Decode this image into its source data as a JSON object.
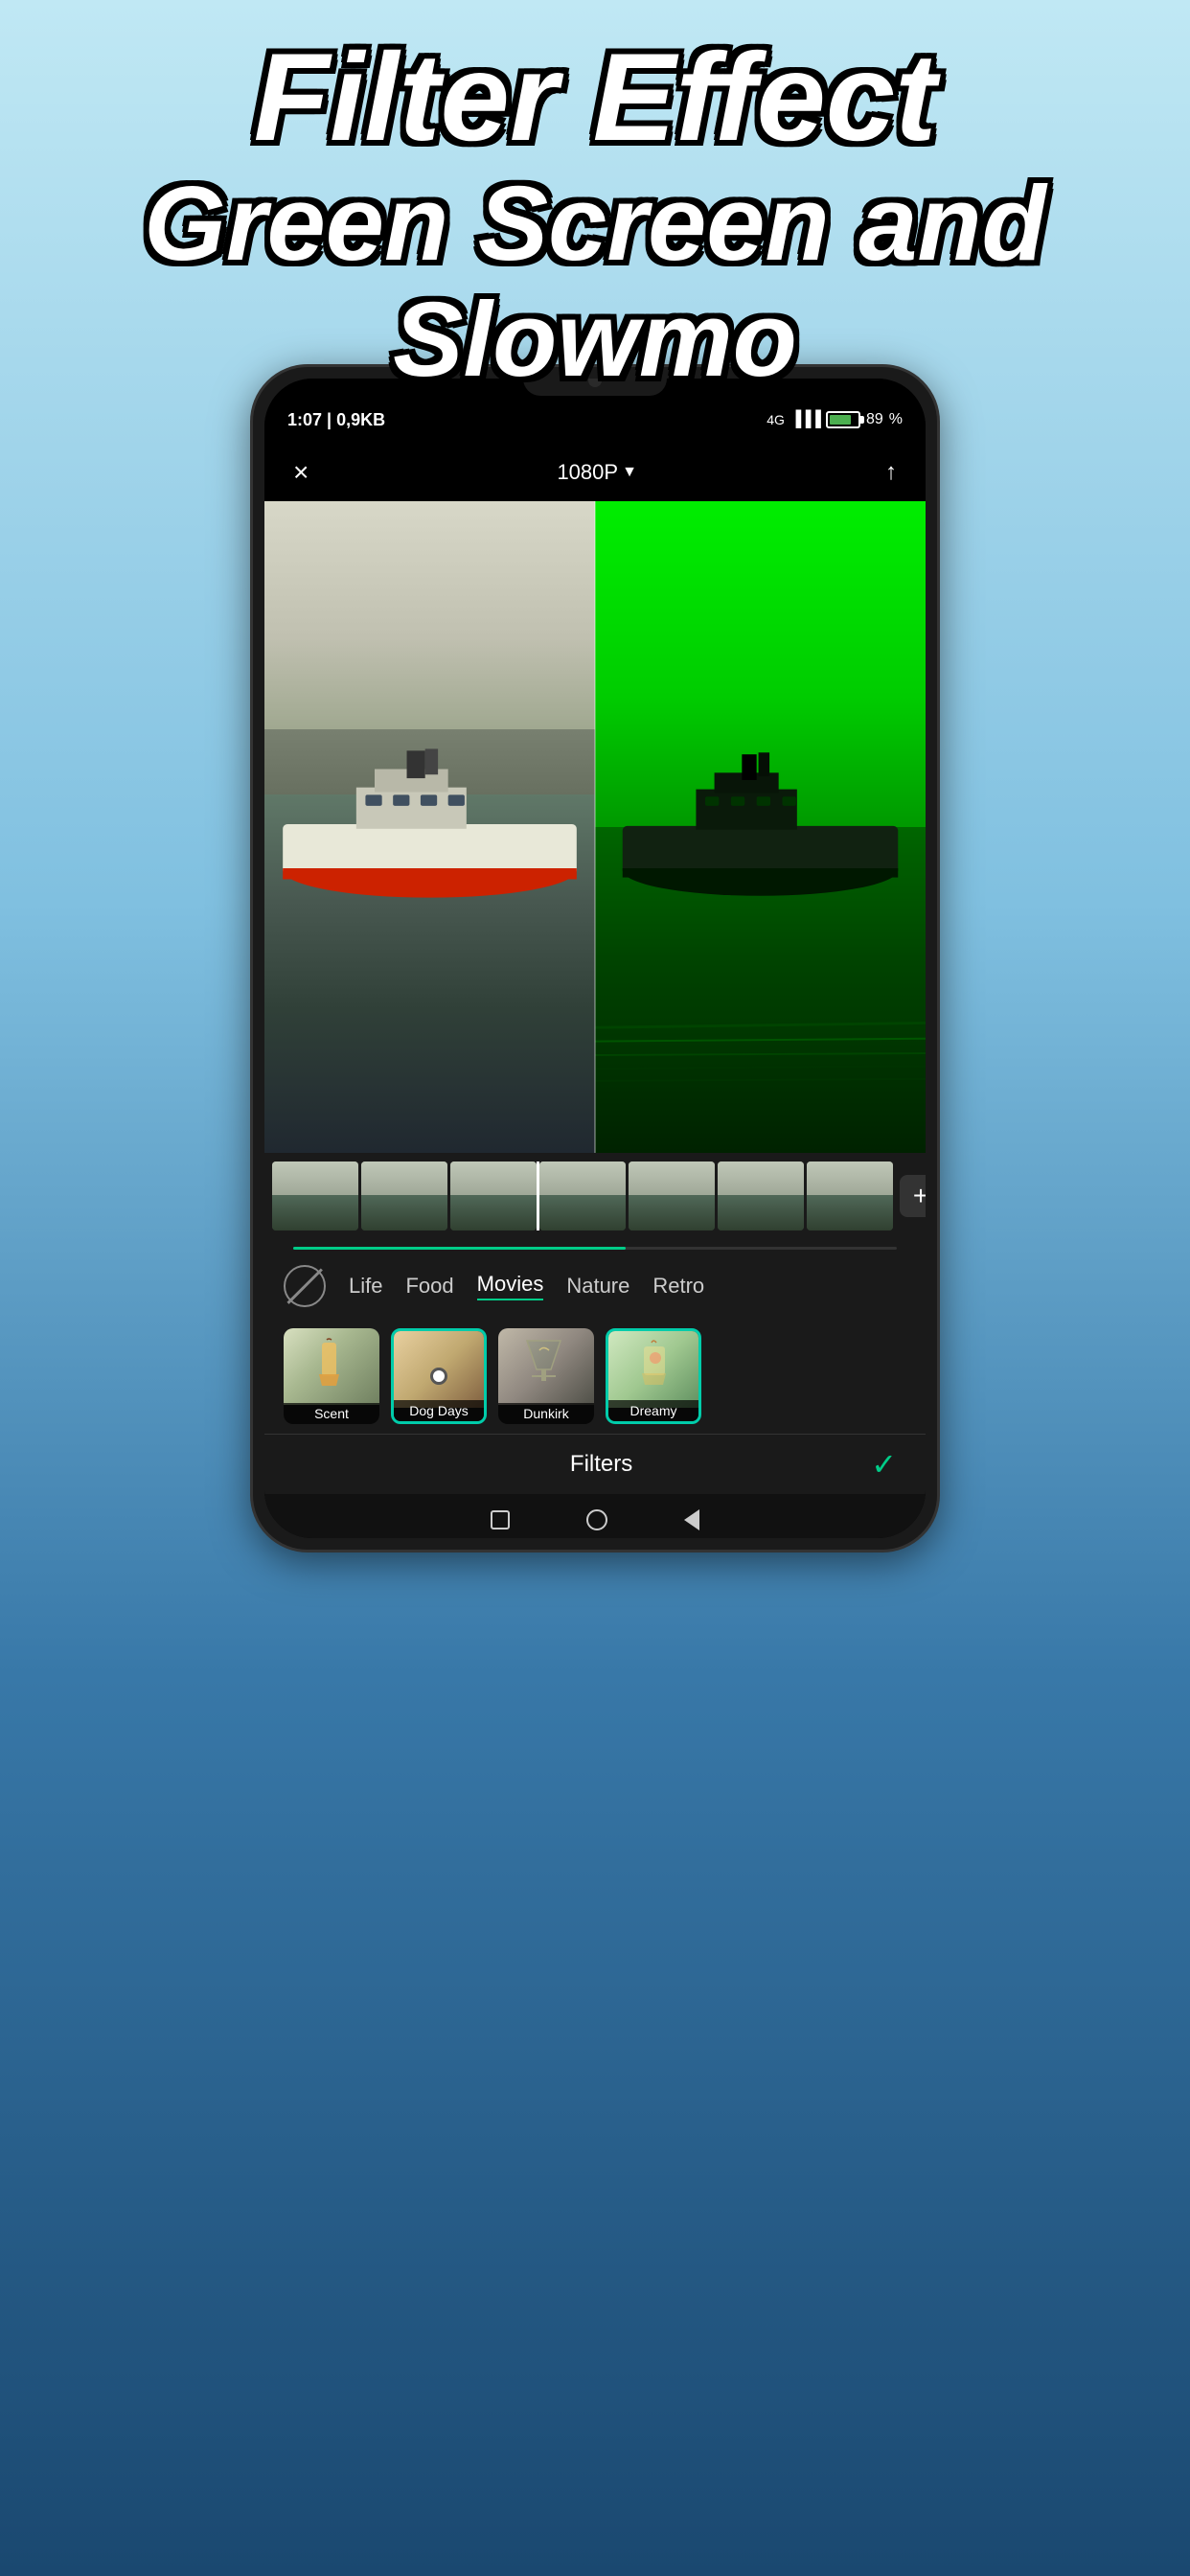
{
  "header": {
    "line1": "Filter Effect",
    "line2": "Green Screen and Slowmo"
  },
  "status_bar": {
    "time": "1:07",
    "data": "0,9KB",
    "network": "4G",
    "battery": "89"
  },
  "toolbar": {
    "quality": "1080P",
    "close_label": "×",
    "share_label": "↑"
  },
  "filter_categories": {
    "items": [
      "Life",
      "Food",
      "Movies",
      "Nature",
      "Retro"
    ],
    "active": "Movies"
  },
  "filter_thumbs": [
    {
      "name": "Scent",
      "type": "scent"
    },
    {
      "name": "Dog Days",
      "type": "dog-days"
    },
    {
      "name": "Dunkirk",
      "type": "dunkirk"
    },
    {
      "name": "Dreamy",
      "type": "dreamy",
      "selected": true
    }
  ],
  "bottom_bar": {
    "label": "Filters",
    "confirm": "✓"
  },
  "add_btn_label": "+",
  "timeline": {
    "thumb_count": 7
  }
}
